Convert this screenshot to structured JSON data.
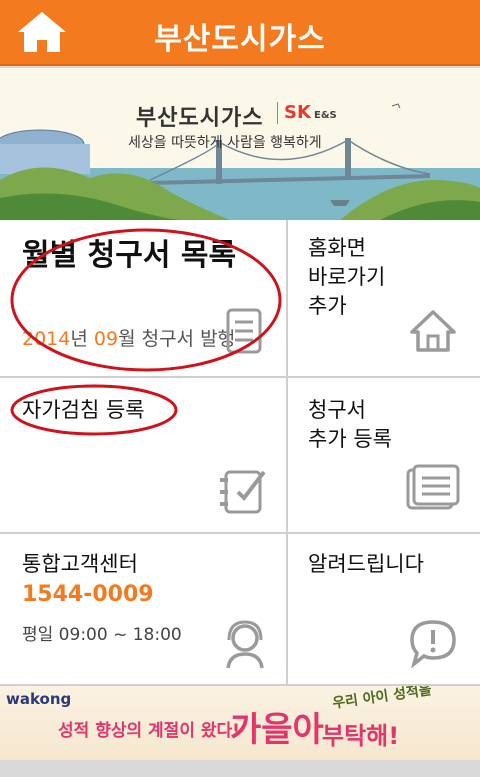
{
  "app": {
    "title": "부산도시가스",
    "home_icon": "home-icon"
  },
  "banner": {
    "company_name": "부산도시가스",
    "logo_text": "SK",
    "logo_sub": "E&S",
    "slogan": "세상을 따뜻하게 사람을 행복하게"
  },
  "tiles": {
    "monthly_bills": {
      "title": "월별 청구서 목록",
      "year": "2014",
      "year_suffix": "년 ",
      "month": "09",
      "month_suffix": "월 청구서 발행",
      "icon": "bill-list-icon"
    },
    "home_shortcut": {
      "title_line1": "홈화면",
      "title_line2": "바로가기",
      "title_line3": "추가",
      "icon": "house-icon"
    },
    "self_reading": {
      "title": "자가검침 등록",
      "icon": "checklist-icon"
    },
    "bill_add": {
      "title_line1": "청구서",
      "title_line2": "추가 등록",
      "icon": "documents-icon"
    },
    "call_center": {
      "title": "통합고객센터",
      "phone": "1544-0009",
      "hours": "평일 09:00 ~ 18:00",
      "icon": "headset-agent-icon"
    },
    "notice": {
      "title": "알려드립니다",
      "icon": "speech-exclamation-icon"
    }
  },
  "ad": {
    "brand": "wakong",
    "text": "성적 향상의 계절이 왔다!",
    "headline": "가을아",
    "headline2": "부탁해!",
    "handwritten": "우리 아이 성적을"
  },
  "colors": {
    "accent": "#f47a20",
    "annotation": "#d0121b"
  }
}
